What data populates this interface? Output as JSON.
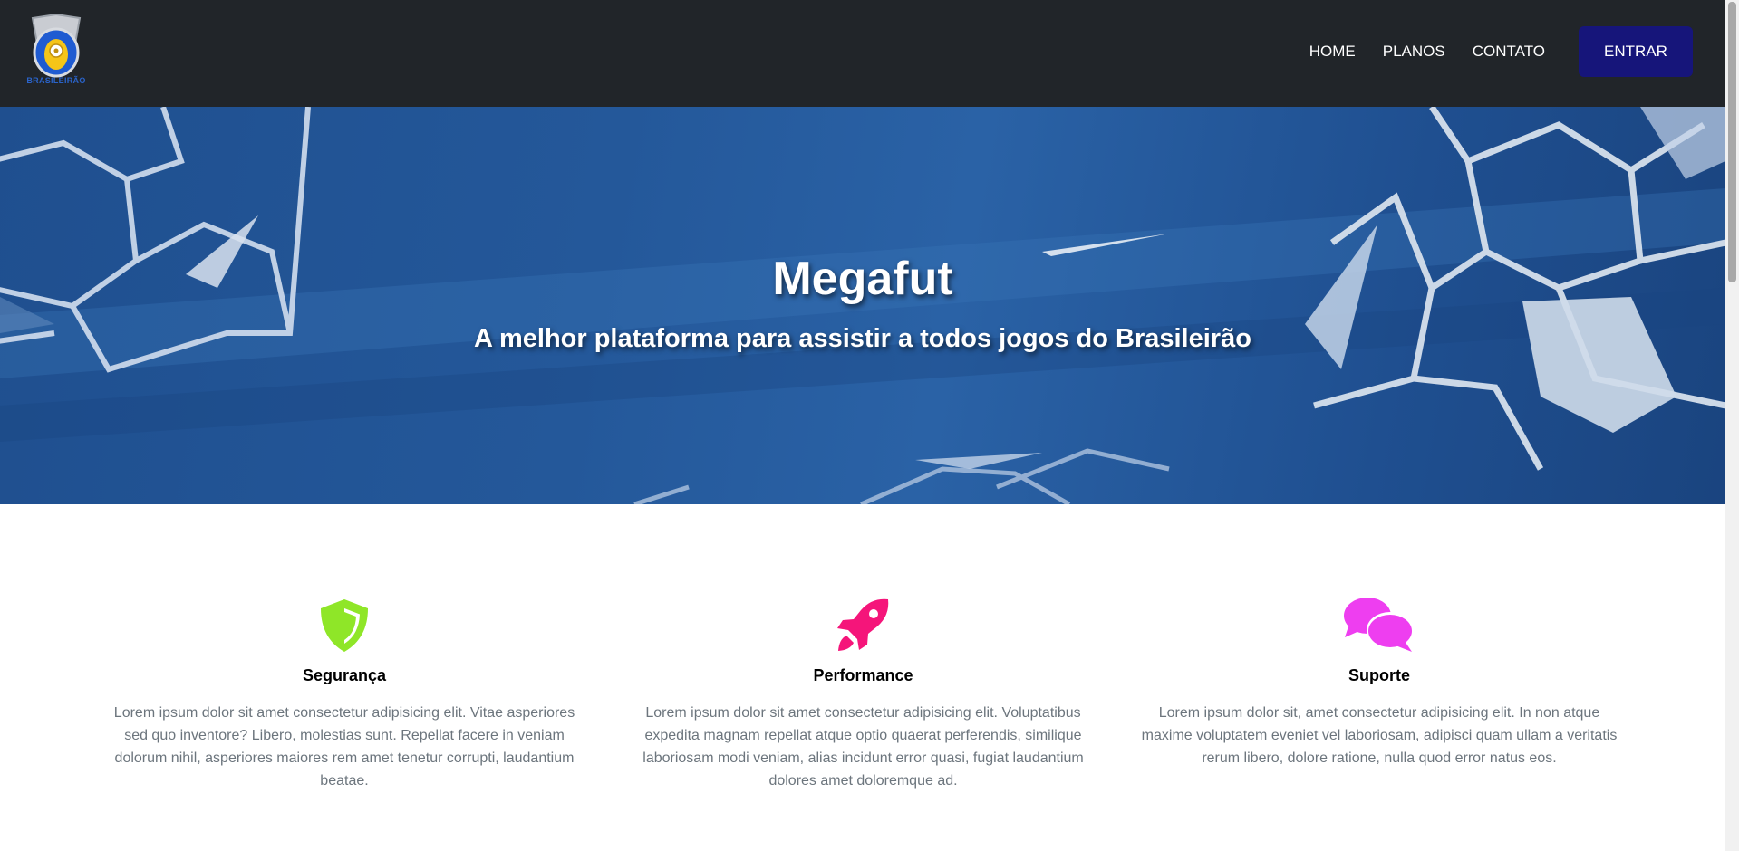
{
  "navbar": {
    "logo_text": "BRASILEIRÃO",
    "links": [
      {
        "label": "HOME"
      },
      {
        "label": "PLANOS"
      },
      {
        "label": "CONTATO"
      }
    ],
    "login_label": "ENTRAR",
    "login_color": "#16157a"
  },
  "hero": {
    "title": "Megafut",
    "subtitle": "A melhor plataforma para assistir a todos jogos do Brasileirão"
  },
  "features": [
    {
      "icon": "shield-icon",
      "color": "#8fe628",
      "title": "Segurança",
      "text": "Lorem ipsum dolor sit amet consectetur adipisicing elit. Vitae asperiores sed quo inventore? Libero, molestias sunt. Repellat facere in veniam dolorum nihil, asperiores maiores rem amet tenetur corrupti, laudantium beatae."
    },
    {
      "icon": "rocket-icon",
      "color": "#f5157a",
      "title": "Performance",
      "text": "Lorem ipsum dolor sit amet consectetur adipisicing elit. Voluptatibus expedita magnam repellat atque optio quaerat perferendis, similique laboriosam modi veniam, alias incidunt error quasi, fugiat laudantium dolores amet doloremque ad."
    },
    {
      "icon": "comments-icon",
      "color": "#ee3ef0",
      "title": "Suporte",
      "text": "Lorem ipsum dolor sit, amet consectetur adipisicing elit. In non atque maxime voluptatem eveniet vel laboriosam, adipisci quam ullam a veritatis rerum libero, dolore ratione, nulla quod error natus eos."
    }
  ]
}
